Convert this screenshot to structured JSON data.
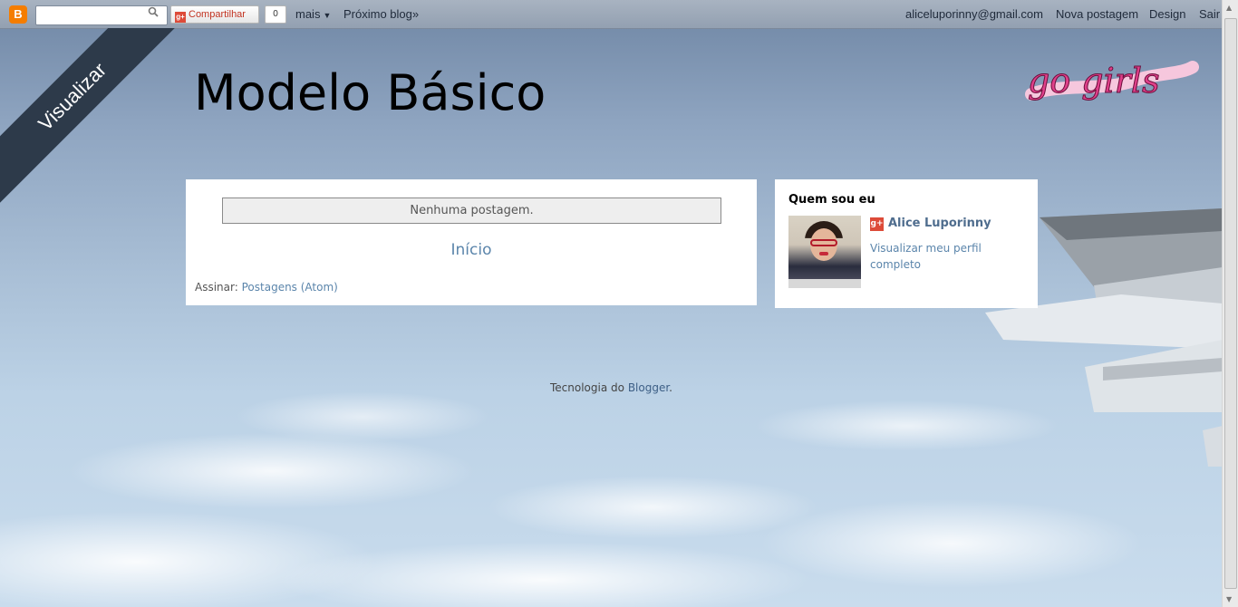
{
  "navbar": {
    "blogger_icon": "B",
    "search_placeholder": "",
    "share_label": "Compartilhar",
    "share_count": "0",
    "more_label": "mais",
    "next_blog_label": "Próximo blog»",
    "email": "aliceluporinny@gmail.com",
    "new_post_label": "Nova postagem",
    "design_label": "Design",
    "exit_label": "Sair"
  },
  "ribbon": {
    "label": "Visualizar"
  },
  "header": {
    "title": "Modelo Básico",
    "logo_text": "go girls"
  },
  "main": {
    "no_posts": "Nenhuma postagem.",
    "home_link": "Início",
    "subscribe_label": "Assinar:",
    "subscribe_link": "Postagens (Atom)"
  },
  "sidebar": {
    "title": "Quem sou eu",
    "profile_name": "Alice Luporinny",
    "profile_link": "Visualizar meu perfil completo"
  },
  "footer": {
    "prefix": "Tecnologia do",
    "link": "Blogger",
    "suffix": "."
  },
  "colors": {
    "link": "#5b85ab",
    "ribbon": "#2d3a4a",
    "gplus": "#dd4b39",
    "logo_pink": "#e0408a"
  }
}
